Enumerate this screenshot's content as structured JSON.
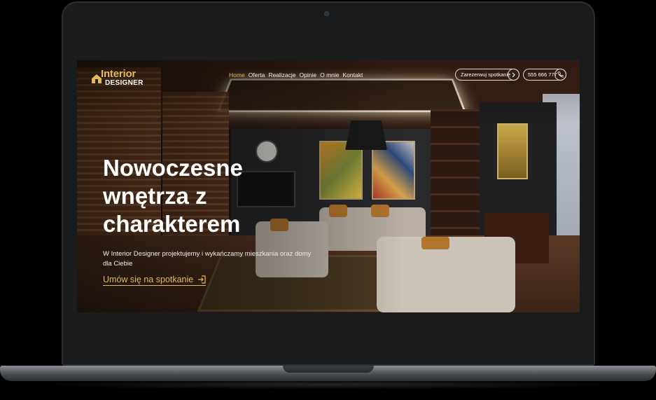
{
  "colors": {
    "accent": "#e0b95a",
    "text": "#ffffff",
    "frame": "#1a1b1c"
  },
  "logo": {
    "line1": "Interior",
    "line2": "DESIGNER",
    "icon": "house-icon"
  },
  "nav": {
    "items": [
      {
        "label": "Home",
        "active": true
      },
      {
        "label": "Oferta"
      },
      {
        "label": "Realizacje"
      },
      {
        "label": "Opinie"
      },
      {
        "label": "O mnie"
      },
      {
        "label": "Kontakt"
      }
    ]
  },
  "header": {
    "book_label": "Zarezerwuj spotkanie",
    "book_icon": "chevron-right-icon",
    "phone_label": "555 666 777",
    "phone_icon": "phone-icon"
  },
  "hero": {
    "title": "Nowoczesne wnętrza z charakterem",
    "subtitle": "W Interior Designer projektujemy i wykańczamy mieszkania oraz domy dla Ciebie",
    "cta_label": "Umów się na spotkanie",
    "cta_icon": "sign-in-icon"
  }
}
